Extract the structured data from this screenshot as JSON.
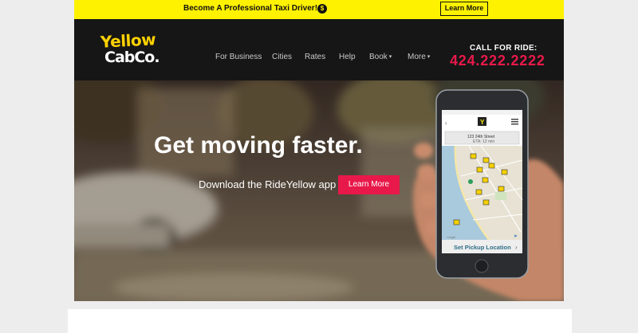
{
  "promo": {
    "text": "Become A Professional Taxi Driver!",
    "icon": "dollar-icon",
    "icon_glyph": "$",
    "button": "Learn More"
  },
  "header": {
    "logo_line1": "Yellow",
    "logo_line2": "CabCo.",
    "nav": [
      {
        "label": "For Business"
      },
      {
        "label": "Cities"
      },
      {
        "label": "Rates"
      },
      {
        "label": "Help"
      },
      {
        "label": "Book",
        "caret": "▾"
      },
      {
        "label": "More",
        "caret": "▾"
      }
    ],
    "call_label": "CALL FOR RIDE:",
    "phone": "424.222.2222"
  },
  "hero": {
    "title": "Get moving faster.",
    "subtitle": "Download the RideYellow app",
    "button": "Learn More",
    "phone_screen": {
      "street": "123 24th Street",
      "eta": "ETA: 12 min",
      "pickup": "Set Pickup Location"
    }
  },
  "colors": {
    "yellow": "#fff200",
    "dark": "#161616",
    "accent": "#e8194a"
  }
}
